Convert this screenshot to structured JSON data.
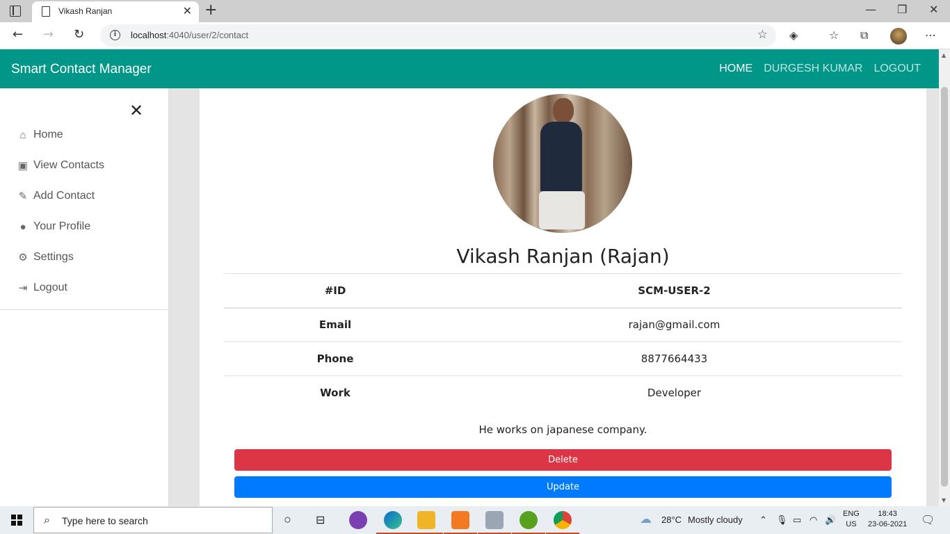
{
  "browser": {
    "tab_title": "Vikash Ranjan",
    "url_host": "localhost",
    "url_path": ":4040/user/2/contact",
    "new_tab_glyph": "+",
    "close_tab_glyph": "✕",
    "icons": [
      "tab-actions-icon",
      "page-icon",
      "back-icon",
      "forward-icon",
      "reload-icon",
      "info-icon",
      "add-favorite-icon",
      "extension-icon",
      "favorites-icon",
      "collections-icon",
      "profile-avatar",
      "more-icon",
      "minimize-icon",
      "maximize-icon",
      "close-window-icon"
    ]
  },
  "navbar": {
    "brand": "Smart Contact Manager",
    "links": [
      "HOME",
      "DURGESH KUMAR",
      "LOGOUT"
    ],
    "color": "#009688"
  },
  "sidebar": {
    "items": [
      {
        "label": "Home",
        "icon": "home-icon"
      },
      {
        "label": "View Contacts",
        "icon": "address-card-icon"
      },
      {
        "label": "Add Contact",
        "icon": "pencil-icon"
      },
      {
        "label": "Your Profile",
        "icon": "user-circle-icon"
      },
      {
        "label": "Settings",
        "icon": "gears-icon"
      },
      {
        "label": "Logout",
        "icon": "sign-out-icon"
      }
    ]
  },
  "contact": {
    "name": "Vikash Ranjan (Rajan)",
    "table": {
      "header": {
        "key": "#ID",
        "value": "SCM-USER-2"
      },
      "rows": [
        {
          "key": "Email",
          "value": "rajan@gmail.com"
        },
        {
          "key": "Phone",
          "value": "8877664433"
        },
        {
          "key": "Work",
          "value": "Developer"
        }
      ]
    },
    "description": "He works on japanese company.",
    "delete_label": "Delete",
    "update_label": "Update",
    "delete_color": "#dc3545",
    "update_color": "#007bff"
  },
  "taskbar": {
    "search_placeholder": "Type here to search",
    "weather_temp": "28°C",
    "weather_text": "Mostly cloudy",
    "lang_top": "ENG",
    "lang_bottom": "US",
    "time": "18:43",
    "date": "23-06-2021"
  }
}
